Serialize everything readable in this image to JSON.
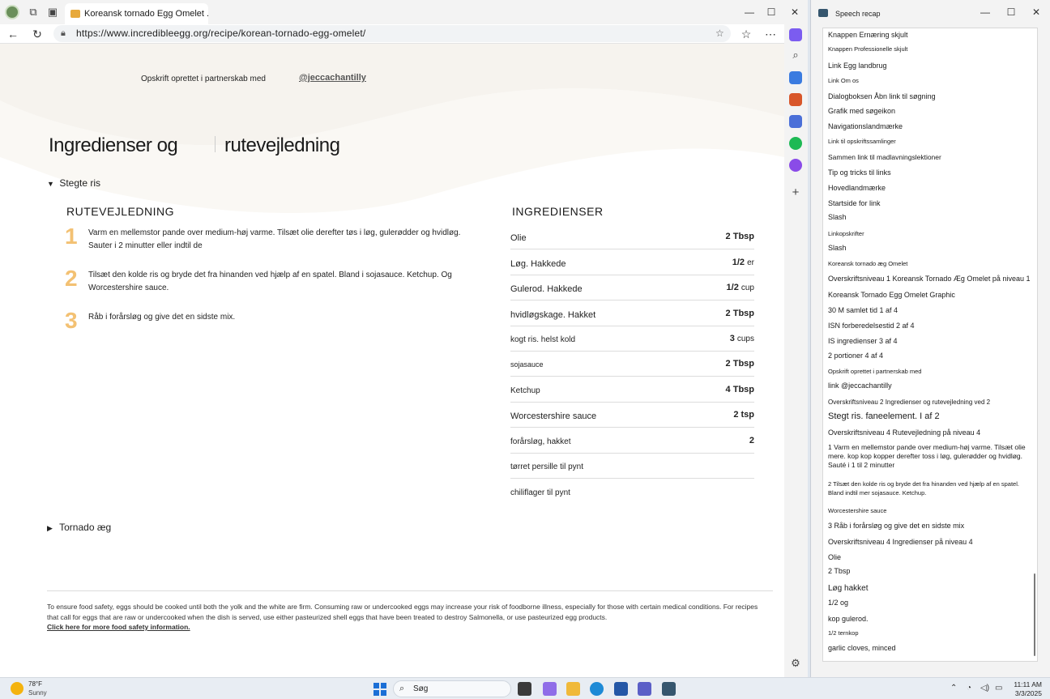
{
  "browser": {
    "tab_title": "Koreansk tornado Egg Omelet . ; x +",
    "url": "https://www.incredibleegg.org/recipe/korean-tornado-egg-omelet/"
  },
  "page": {
    "partner_text": "Opskrift oprettet i partnerskab med",
    "partner_link": "@jeccachantilly",
    "heading_a": "Ingredienser og",
    "heading_b": "rutevejledning",
    "accordion_1": "Stegte ris",
    "accordion_2": "Tornado æg",
    "directions_heading": "RUTEVEJLEDNING",
    "steps": [
      {
        "num": "1",
        "text": "Varm en mellemstor pande over medium-høj varme. Tilsæt olie derefter tøs i løg, gulerødder og hvidløg. Sauter i 2 minutter eller indtil de"
      },
      {
        "num": "2",
        "text": "Tilsæt den kolde ris og bryde det fra hinanden ved hjælp af en spatel. Bland i sojasauce. Ketchup. Og Worcestershire sauce."
      },
      {
        "num": "3",
        "text": "Råb i forårsløg og give det en sidste mix."
      }
    ],
    "ingredients_heading": "INGREDIENSER",
    "ingredients": [
      {
        "name": "Olie",
        "qty": "2 Tbsp",
        "unit": ""
      },
      {
        "name": "Løg. Hakkede",
        "qty": "1/2",
        "unit": "er"
      },
      {
        "name": "Gulerod. Hakkede",
        "qty": "1/2",
        "unit": "cup"
      },
      {
        "name": "hvidløgskage. Hakket",
        "qty": "2 Tbsp",
        "unit": ""
      },
      {
        "name": "kogt ris. helst kold",
        "qty": "3",
        "unit": "cups"
      },
      {
        "name": "sojasauce",
        "qty": "2 Tbsp",
        "unit": ""
      },
      {
        "name": "Ketchup",
        "qty": "4 Tbsp",
        "unit": ""
      },
      {
        "name": "Worcestershire sauce",
        "qty": "2 tsp",
        "unit": ""
      },
      {
        "name": "forårsløg, hakket",
        "qty": "2",
        "unit": ""
      },
      {
        "name": "tørret persille til pynt",
        "qty": "",
        "unit": ""
      },
      {
        "name": "chiliflager til pynt",
        "qty": "",
        "unit": ""
      }
    ],
    "footer_text": "To ensure food safety, eggs should be cooked until both the yolk and the white are firm. Consuming raw or undercooked eggs may increase your risk of foodborne illness, especially for those with certain medical conditions. For recipes that call for eggs that are raw or undercooked when the dish is served, use either pasteurized shell eggs that have been treated to destroy Salmonella, or use pasteurized egg products.",
    "footer_link": "Click here for more food safety information."
  },
  "recap": {
    "title": "Speech recap",
    "lines": [
      "Knappen Ernæring skjult",
      "Knappen Professionelle skjult",
      "Link Egg landbrug",
      "Link Om os",
      "Dialogboksen Åbn link til søgning",
      "Grafik med søgeikon",
      "Navigationslandmærke",
      "Link til opskriftssamlinger",
      "Sammen link til madlavningslektioner",
      "Tip og tricks til links",
      "Hovedlandmærke",
      "Startside for link",
      "Slash",
      "Linkopskrifter",
      "Slash",
      "Koreansk tornado æg Omelet",
      "Overskriftsniveau 1 Koreansk Tornado Æg Omelet på niveau 1",
      "Koreansk Tornado Egg Omelet Graphic",
      "30 M samlet tid 1 af 4",
      "ISN forberedelsestid 2 af 4",
      "IS ingredienser 3 af 4",
      "2 portioner 4 af 4",
      "Opskrift oprettet i partnerskab med",
      "link @jeccachantilly",
      "Overskriftsniveau 2 Ingredienser og rutevejledning ved 2",
      "Stegt ris. faneelement. I af 2",
      "Overskriftsniveau 4 Rutevejledning på niveau 4",
      "1 Varm en mellemstor pande over medium-høj varme. Tilsæt olie mere. kop kop kopper derefter toss i løg, gulerødder og hvidløg. Sauté i 1 til 2 minutter",
      "2 Tilsæt den kolde ris og bryde det fra hinanden ved hjælp af en spatel. Bland indtil mer sojasauce. Ketchup.",
      "Worcestershire sauce",
      "3 Råb i forårsløg og give det en sidste mix",
      "Overskriftsniveau 4 Ingredienser på niveau 4",
      "Olie",
      "2 Tbsp",
      "Løg hakket",
      "1/2 og",
      "kop gulerod.",
      "1/2 ternkop",
      "garlic cloves, minced"
    ]
  },
  "taskbar": {
    "temp": "78°F",
    "condition": "Sunny",
    "search": "Søg",
    "time": "11:11 AM",
    "date": "3/3/2025"
  }
}
